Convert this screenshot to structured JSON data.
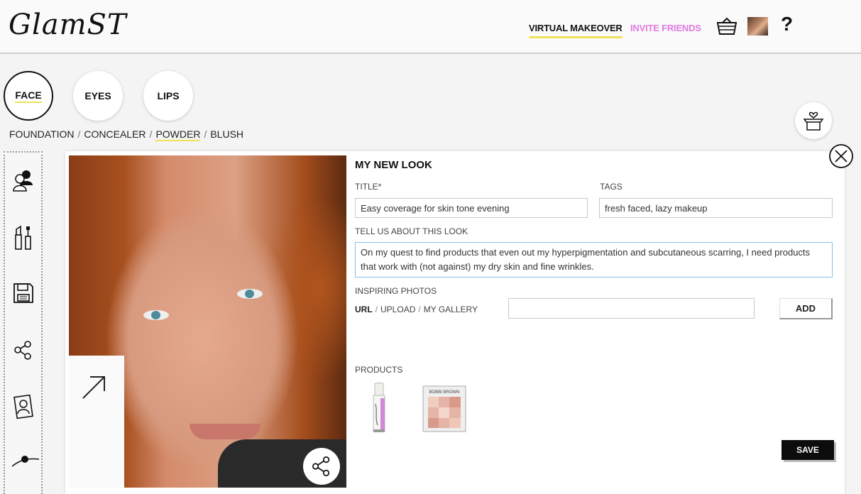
{
  "header": {
    "logo": "GlamST",
    "nav": [
      {
        "label": "VIRTUAL MAKEOVER",
        "active": true
      },
      {
        "label": "INVITE FRIENDS",
        "active": false,
        "color": "#e07ae0"
      }
    ],
    "help": "?"
  },
  "categories": [
    {
      "label": "FACE",
      "active": true
    },
    {
      "label": "EYES",
      "active": false
    },
    {
      "label": "LIPS",
      "active": false
    }
  ],
  "subnav": {
    "items": [
      "FOUNDATION",
      "CONCEALER",
      "POWDER",
      "BLUSH"
    ],
    "separator": "/",
    "active": "POWDER"
  },
  "sidebar_icons": [
    "people-icon",
    "makeup-tools-icon",
    "save-disk-icon",
    "share-icon",
    "portrait-icon",
    "slider-icon"
  ],
  "form": {
    "title": "MY NEW LOOK",
    "title_label": "TITLE*",
    "title_value": "Easy coverage for skin tone evening",
    "tags_label": "TAGS",
    "tags_value": "fresh faced, lazy makeup",
    "about_label": "TELL US ABOUT THIS LOOK",
    "about_value": "On my quest to find products that even out my hyperpigmentation and subcutaneous scarring, I need products that work with (not against) my dry skin and fine wrinkles.",
    "inspiring_label": "INSPIRING PHOTOS",
    "photo_sources": [
      "URL",
      "UPLOAD",
      "MY GALLERY"
    ],
    "photo_source_active": "URL",
    "url_value": "",
    "add_label": "ADD",
    "products_label": "PRODUCTS",
    "products": [
      {
        "icon": "lip-primer-tube-icon"
      },
      {
        "icon": "powder-compact-icon",
        "brand": "BOBBI BROWN"
      }
    ],
    "save_label": "SAVE"
  },
  "colors": {
    "accent_underline": "#f0e05a",
    "invite_pink": "#e07ae0",
    "save_button": "#0c0c0c",
    "textarea_focus": "#89c0e6"
  }
}
